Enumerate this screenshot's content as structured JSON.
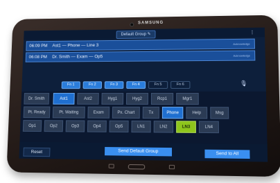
{
  "device": {
    "brand": "SAMSUNG"
  },
  "header": {
    "group_label": "Default Group ✎"
  },
  "messages": [
    {
      "time": "06:09 PM",
      "text": "Ast1 — Phone — Line 3",
      "ack": "Acknowledge"
    },
    {
      "time": "06:08 PM",
      "text": "Dr. Smith — Exam — Op5",
      "ack": "Acknowledge"
    }
  ],
  "function_keys": [
    {
      "label": "Fn 1",
      "active": true
    },
    {
      "label": "Fn 2",
      "active": true
    },
    {
      "label": "Fn 3",
      "active": true
    },
    {
      "label": "Fn 4",
      "active": true
    },
    {
      "label": "Fn 5",
      "active": false
    },
    {
      "label": "Fn 6",
      "active": false
    }
  ],
  "grid": {
    "row1": [
      "Dr. Smith",
      "Ast1",
      "Ast2",
      "Hyg1",
      "Hyg2",
      "Rcp1",
      "Mgr1"
    ],
    "row2": [
      "Pt. Ready",
      "Pt. Waiting",
      "Exam",
      "Px. Chart",
      "Tx",
      "Phone",
      "Help",
      "Msg"
    ],
    "row3": [
      "Op1",
      "Op2",
      "Op3",
      "Op4",
      "Op5",
      "LN1",
      "LN2",
      "LN3",
      "LN4"
    ]
  },
  "actions": {
    "reset": "Reset",
    "send_group": "Send Default Group",
    "send_all": "Send to All"
  },
  "colors": {
    "accent": "#3a8ff0",
    "selected": "#1f6fd0",
    "lit": "#8ec51c",
    "screen_bg": "#0d1f3b"
  }
}
